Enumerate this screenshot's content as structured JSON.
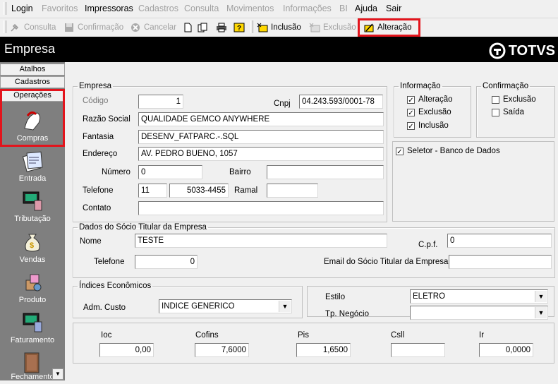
{
  "menu": [
    "Login",
    "Favoritos",
    "Impressoras",
    "Cadastros",
    "Consulta",
    "Movimentos",
    "Informações",
    "BI",
    "Ajuda",
    "Sair"
  ],
  "toolbar": {
    "consulta": "Consulta",
    "confirmacao": "Confirmação",
    "cancelar": "Cancelar",
    "inclusao": "Inclusão",
    "exclusao": "Exclusão",
    "alteracao": "Alteração"
  },
  "header": {
    "title": "Empresa",
    "brand": "TOTVS"
  },
  "sidebar": {
    "tabs": [
      "Atalhos",
      "Cadastros",
      "Operações"
    ],
    "items": [
      "Compras",
      "Entrada",
      "Tributação",
      "Vendas",
      "Produto",
      "Faturamento",
      "Fechamento"
    ]
  },
  "empresa": {
    "legend": "Empresa",
    "codigo_label": "Código",
    "codigo": "1",
    "cnpj_label": "Cnpj",
    "cnpj": "04.243.593/0001-78",
    "razao_label": "Razão Social",
    "razao": "QUALIDADE GEMCO ANYWHERE",
    "fantasia_label": "Fantasia",
    "fantasia": "DESENV_FATPARC.-.SQL",
    "endereco_label": "Endereço",
    "endereco": "AV. PEDRO BUENO, 1057",
    "numero_label": "Número",
    "numero": "0",
    "bairro_label": "Bairro",
    "bairro": "",
    "telefone_label": "Telefone",
    "ddd": "11",
    "telefone": "5033-4455",
    "ramal_label": "Ramal",
    "ramal": "",
    "contato_label": "Contato",
    "contato": ""
  },
  "informacao": {
    "legend": "Informação",
    "alteracao": "Alteração",
    "exclusao": "Exclusão",
    "inclusao": "Inclusão"
  },
  "confirmacao": {
    "legend": "Confirmação",
    "exclusao": "Exclusão",
    "saida": "Saída"
  },
  "seletor": "Seletor - Banco de Dados",
  "socio": {
    "legend": "Dados do Sócio Titular da Empresa",
    "nome_label": "Nome",
    "nome": "TESTE",
    "cpf_label": "C.p.f.",
    "cpf": "0",
    "telefone_label": "Telefone",
    "telefone": "0",
    "email_label": "Email do Sócio Titular da Empresa",
    "email": ""
  },
  "indices": {
    "legend": "Índices Econômicos",
    "adm_label": "Adm. Custo",
    "adm": "INDICE GENERICO"
  },
  "estilo": {
    "estilo_label": "Estilo",
    "estilo": "ELETRO",
    "tp_label": "Tp. Negócio",
    "tp": ""
  },
  "impostos": {
    "ioc_label": "Ioc",
    "ioc": "0,00",
    "cofins_label": "Cofins",
    "cofins": "7,6000",
    "pis_label": "Pis",
    "pis": "1,6500",
    "csll_label": "Csll",
    "csll": "",
    "ir_label": "Ir",
    "ir": "0,0000"
  }
}
